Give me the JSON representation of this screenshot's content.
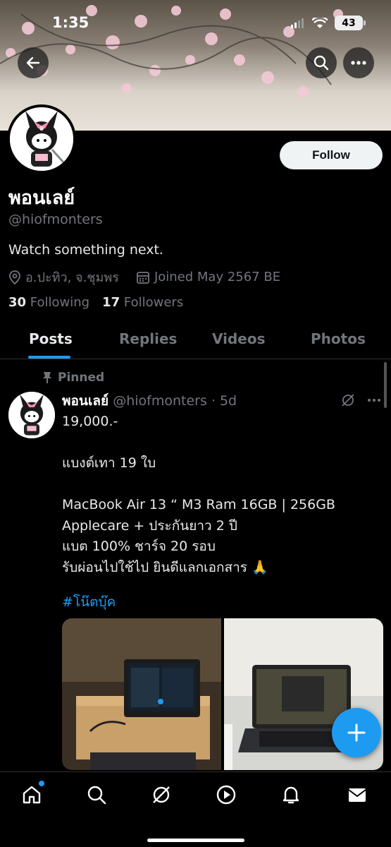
{
  "status_bar": {
    "time": "1:35",
    "battery": "43"
  },
  "header": {
    "back_icon": "back-arrow-icon",
    "search_icon": "search-icon",
    "more_icon": "more-icon"
  },
  "profile": {
    "display_name": "พอนเลย์",
    "handle": "@hiofmonters",
    "bio": "Watch something next.",
    "location": "อ.ปะทิว, จ.ชุมพร",
    "joined": "Joined May 2567 BE",
    "following_count": "30",
    "following_label": "Following",
    "followers_count": "17",
    "followers_label": "Followers",
    "follow_button": "Follow"
  },
  "tabs": [
    {
      "label": "Posts",
      "active": true
    },
    {
      "label": "Replies",
      "active": false
    },
    {
      "label": "Videos",
      "active": false
    },
    {
      "label": "Photos",
      "active": false
    }
  ],
  "post": {
    "pinned_label": "Pinned",
    "author_name": "พอนเลย์",
    "author_handle": "@hiofmonters",
    "time": "· 5d",
    "body": "19,000.-\n\nแบงต์เทา 19 ใบ\n\nMacBook Air 13 “ M3 Ram 16GB | 256GB\nApplecare + ประกันยาว 2 ปี\nแบต 100% ชาร์จ 20 รอบ\nรับผ่อนไปใช้ไป ยินดีแลกเอกสาร 🙏",
    "hashtag": "#โน๊ตบุ๊ค"
  },
  "colors": {
    "accent": "#1d9bf0",
    "muted": "#71767b",
    "text": "#e7e9ea"
  }
}
